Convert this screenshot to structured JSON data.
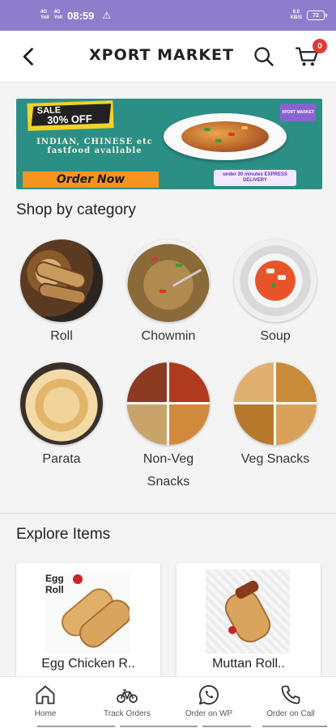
{
  "status_bar": {
    "net1": "4G",
    "net2": "4G",
    "time": "08:59",
    "speed": "0.0",
    "speed_unit": "KB/S",
    "battery": "72"
  },
  "app_bar": {
    "title": "XPORT MARKET",
    "cart_count": "0"
  },
  "banner": {
    "sale_top": "SALE",
    "sale_pct": "30% OFF",
    "text": "INDIAN, CHINESE etc fastfood available",
    "order_label": "Order Now",
    "brand_tag": "XPORT MARKET",
    "delivery": "under 30 minutes EXPRESS DELIVERY"
  },
  "categories_title": "Shop by category",
  "categories": [
    {
      "label": "Roll"
    },
    {
      "label": "Chowmin"
    },
    {
      "label": "Soup"
    },
    {
      "label": "Parata"
    },
    {
      "label": "Non-Veg Snacks"
    },
    {
      "label": "Veg Snacks"
    }
  ],
  "explore_title": "Explore Items",
  "items": [
    {
      "name": "Egg Chicken R..",
      "tag": "Egg Roll"
    },
    {
      "name": "Muttan Roll.."
    }
  ],
  "bottom_nav": [
    {
      "label": "Home",
      "icon": "home-icon"
    },
    {
      "label": "Track Orders",
      "icon": "bicycle-icon"
    },
    {
      "label": "Order on WP",
      "icon": "whatsapp-icon"
    },
    {
      "label": "Order on Call",
      "icon": "phone-icon"
    }
  ],
  "colors": {
    "status_bar": "#8e7ccc",
    "banner_bg": "#2c8f86",
    "badge": "#e53935",
    "order_btn": "#f7931e"
  }
}
